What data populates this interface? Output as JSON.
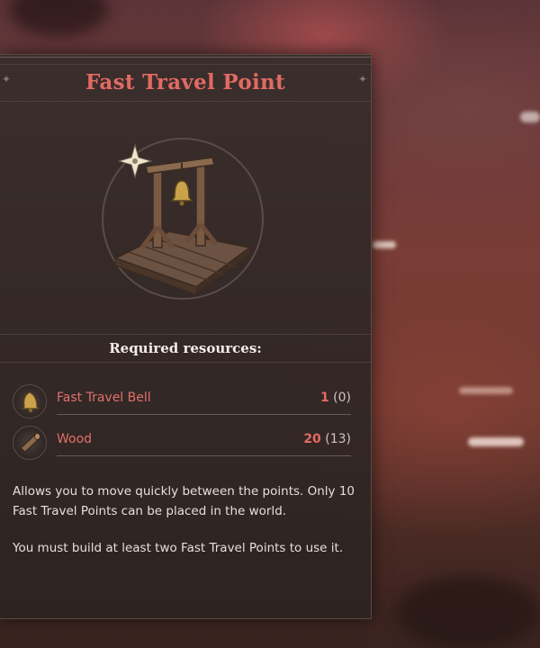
{
  "panel": {
    "title": "Fast Travel Point",
    "building_icon": "bell-gallows-icon",
    "required_label": "Required resources:"
  },
  "resources": [
    {
      "name": "Fast Travel Bell",
      "icon": "bell-icon",
      "required": "1",
      "owned": "(0)"
    },
    {
      "name": "Wood",
      "icon": "wood-log-icon",
      "required": "20",
      "owned": "(13)"
    }
  ],
  "description": {
    "line1": "Allows you to move quickly between the points. Only 10 Fast Travel Points can be placed in the world.",
    "line2": "You must build at least two Fast Travel Points to use it."
  },
  "colors": {
    "title": "#e26a62",
    "resource_name": "#e0706a",
    "required_amount": "#e46a60",
    "panel_bg": "#302826"
  }
}
